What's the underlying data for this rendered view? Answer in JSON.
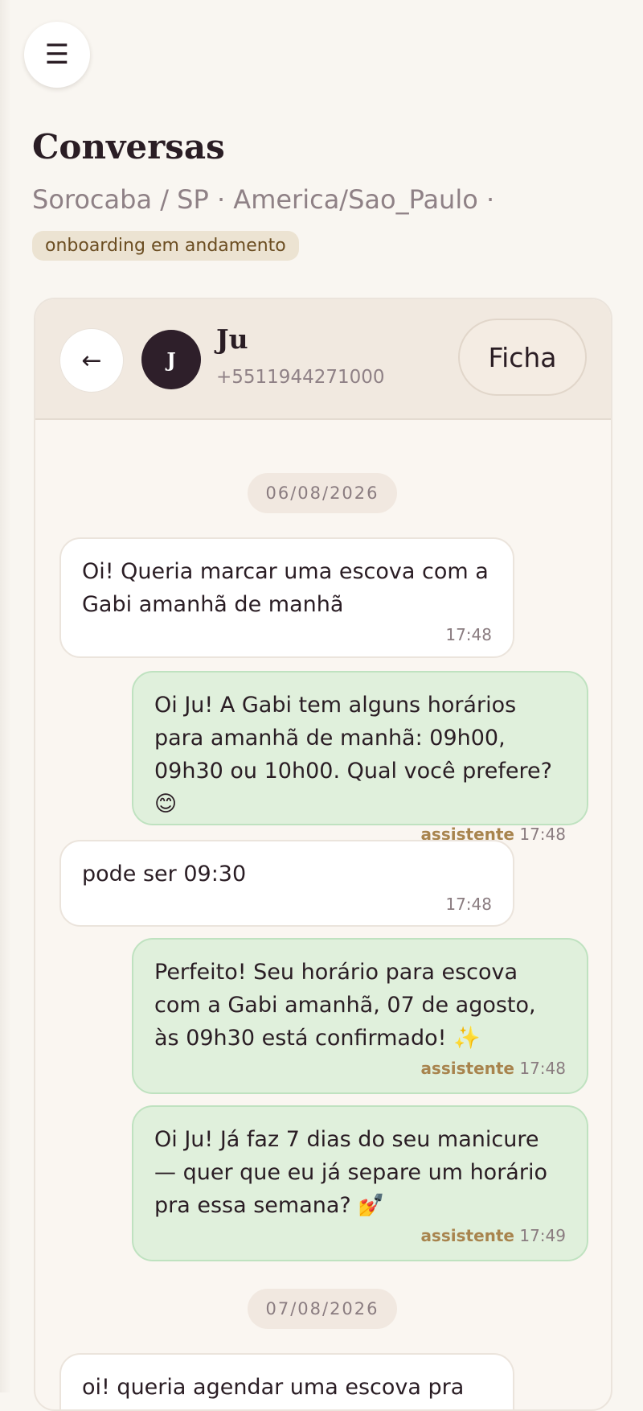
{
  "menu": {
    "icon": "menu-icon",
    "glyph": "☰"
  },
  "page": {
    "title": "Conversas",
    "location": "Sorocaba / SP · America/Sao_Paulo ·",
    "status_badge": "onboarding em andamento"
  },
  "chat": {
    "back_glyph": "←",
    "contact": {
      "initial": "J",
      "name": "Ju",
      "phone": "+5511944271000"
    },
    "ficha_label": "Ficha"
  },
  "messages": {
    "date_1": "06/08/2026",
    "m1": {
      "text": "Oi! Queria marcar uma escova com a Gabi amanhã de manhã",
      "time": "17:48"
    },
    "m2": {
      "text": "Oi Ju! A Gabi tem alguns horários para amanhã de manhã: 09h00, 09h30 ou 10h00. Qual você prefere? 😊",
      "role": "assistente",
      "time": "17:48"
    },
    "m3": {
      "text": "pode ser 09:30",
      "time": "17:48"
    },
    "m4": {
      "text": "Perfeito! Seu horário para escova com a Gabi amanhã, 07 de agosto, às 09h30 está confirmado! ✨",
      "role": "assistente",
      "time": "17:48"
    },
    "m5": {
      "text": "Oi Ju! Já faz 7 dias do seu manicure — quer que eu já separe um horário pra essa semana? 💅",
      "role": "assistente",
      "time": "17:49"
    },
    "date_2": "07/08/2026",
    "m6": {
      "text": "oi! queria agendar uma escova pra"
    }
  }
}
